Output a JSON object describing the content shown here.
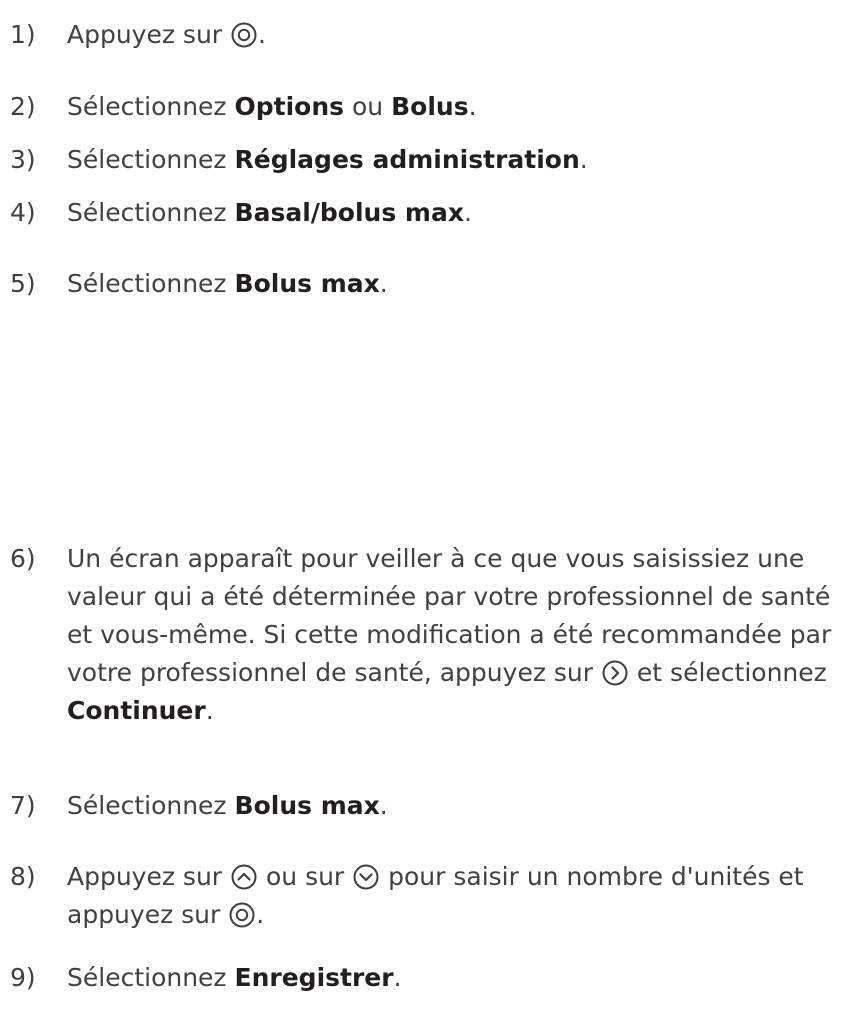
{
  "accent_color": "#414042",
  "steps": [
    {
      "num": "1)",
      "parts": [
        {
          "t": "Appuyez sur "
        },
        {
          "icon": "ok"
        },
        {
          "t": "."
        }
      ]
    },
    {
      "num": "2)",
      "parts": [
        {
          "t": "Sélectionnez "
        },
        {
          "b": "Options"
        },
        {
          "t": " ou "
        },
        {
          "b": "Bolus"
        },
        {
          "t": "."
        }
      ]
    },
    {
      "num": "3)",
      "parts": [
        {
          "t": "Sélectionnez "
        },
        {
          "b": "Réglages administration"
        },
        {
          "t": "."
        }
      ]
    },
    {
      "num": "4)",
      "parts": [
        {
          "t": "Sélectionnez "
        },
        {
          "b": "Basal/bolus max"
        },
        {
          "t": "."
        }
      ]
    },
    {
      "num": "5)",
      "parts": [
        {
          "t": "Sélectionnez "
        },
        {
          "b": "Bolus max"
        },
        {
          "t": "."
        }
      ]
    },
    {
      "num": "6)",
      "parts": [
        {
          "t": "Un écran apparaît pour veiller à ce que vous saisissiez une valeur qui a été déterminée par votre professionnel de santé et vous-même. Si cette modification a été recommandée par votre professionnel de santé,  appuyez sur "
        },
        {
          "icon": "right"
        },
        {
          "t": " et sélectionnez "
        },
        {
          "b": "Continuer"
        },
        {
          "t": "."
        }
      ]
    },
    {
      "num": "7)",
      "parts": [
        {
          "t": "Sélectionnez "
        },
        {
          "b": "Bolus max"
        },
        {
          "t": "."
        }
      ]
    },
    {
      "num": "8)",
      "parts": [
        {
          "t": "Appuyez sur "
        },
        {
          "icon": "up"
        },
        {
          "t": " ou sur "
        },
        {
          "icon": "down"
        },
        {
          "t": " pour saisir un nombre d'unités et appuyez sur "
        },
        {
          "icon": "ok"
        },
        {
          "t": "."
        }
      ]
    },
    {
      "num": "9)",
      "parts": [
        {
          "t": "Sélectionnez "
        },
        {
          "b": "Enregistrer"
        },
        {
          "t": "."
        }
      ]
    }
  ]
}
